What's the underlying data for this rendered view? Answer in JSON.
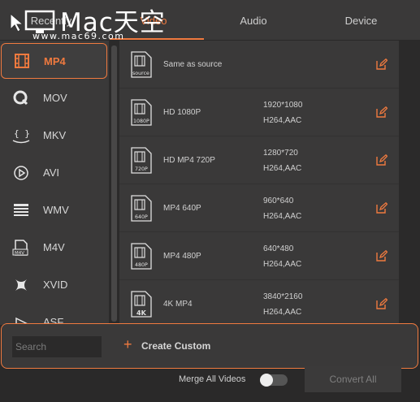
{
  "watermark": {
    "title": "Mac天空",
    "url": "www.mac69.com"
  },
  "tabs": [
    {
      "label": "Recently"
    },
    {
      "label": "Video"
    },
    {
      "label": "Audio"
    },
    {
      "label": "Device"
    }
  ],
  "formats": [
    {
      "label": "MP4",
      "icon": "film-icon",
      "active": true
    },
    {
      "label": "MOV",
      "icon": "quicktime-icon"
    },
    {
      "label": "MKV",
      "icon": "mkv-icon"
    },
    {
      "label": "AVI",
      "icon": "play-circle-icon"
    },
    {
      "label": "WMV",
      "icon": "wmv-icon"
    },
    {
      "label": "M4V",
      "icon": "m4v-icon"
    },
    {
      "label": "XVID",
      "icon": "xvid-icon"
    },
    {
      "label": "ASF",
      "icon": "asf-icon"
    }
  ],
  "presets": [
    {
      "name": "Same as source",
      "badge": "source",
      "res": "",
      "codec": ""
    },
    {
      "name": "HD 1080P",
      "badge": "1080P",
      "res": "1920*1080",
      "codec": "H264,AAC"
    },
    {
      "name": "HD MP4 720P",
      "badge": "720P",
      "res": "1280*720",
      "codec": "H264,AAC"
    },
    {
      "name": "MP4 640P",
      "badge": "640P",
      "res": "960*640",
      "codec": "H264,AAC"
    },
    {
      "name": "MP4 480P",
      "badge": "480P",
      "res": "640*480",
      "codec": "H264,AAC"
    },
    {
      "name": "4K MP4",
      "badge": "4K",
      "res": "3840*2160",
      "codec": "H264,AAC"
    }
  ],
  "custom": {
    "search_placeholder": "Search",
    "create_label": "Create Custom"
  },
  "footer": {
    "merge_label": "Merge All Videos",
    "merge_on": false,
    "convert_label": "Convert All"
  },
  "colors": {
    "accent": "#f07a3f",
    "panel": "#3a3939",
    "background": "#2a2929"
  }
}
